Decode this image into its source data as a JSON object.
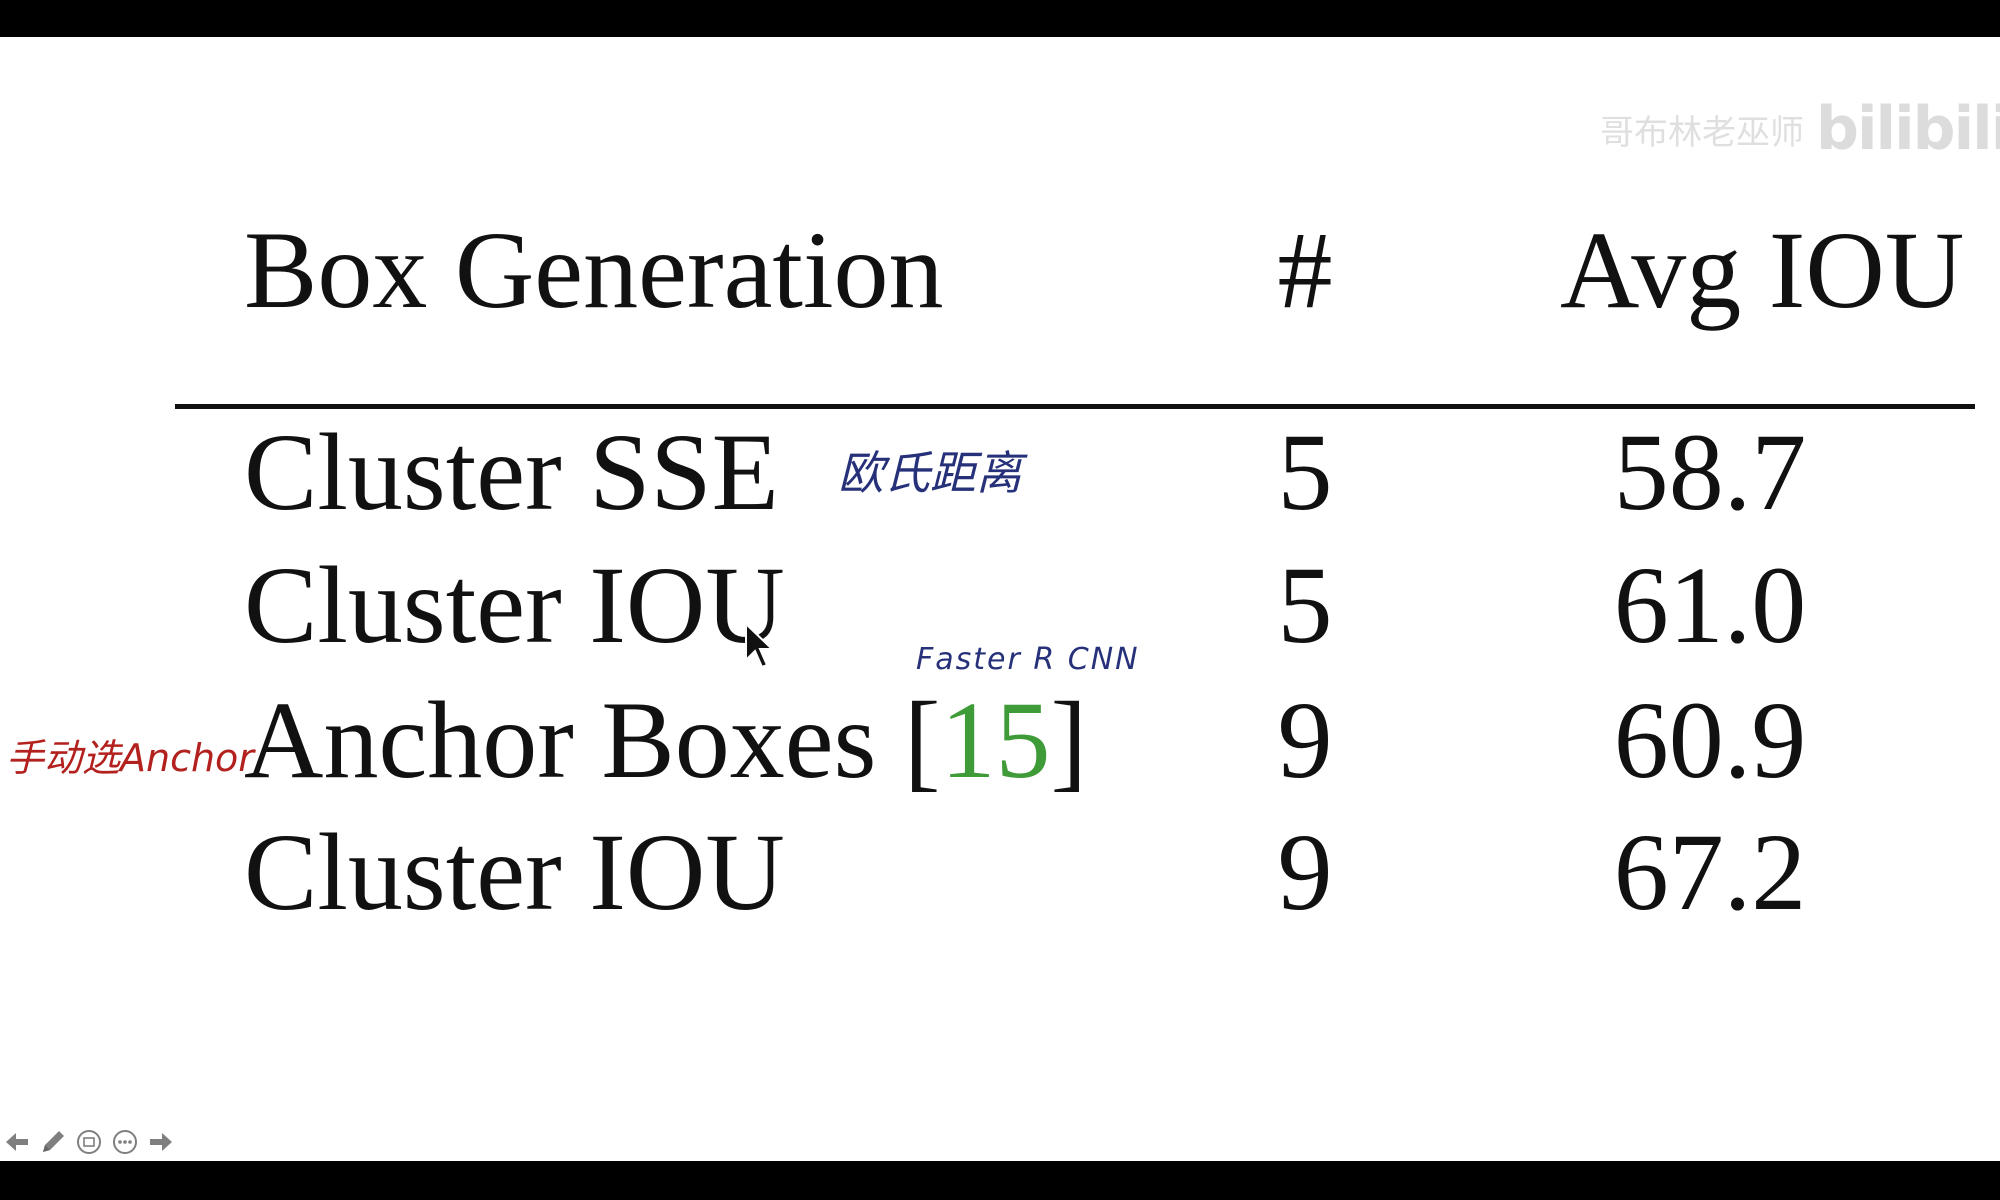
{
  "watermark": {
    "text": "哥布林老巫师",
    "logo_text": "bilibili"
  },
  "table": {
    "headers": {
      "box_generation": "Box Generation",
      "count": "#",
      "avg_iou": "Avg IOU"
    },
    "rows": [
      {
        "method": "Cluster SSE",
        "count": "5",
        "avg_iou": "58.7"
      },
      {
        "method": "Cluster IOU",
        "count": "5",
        "avg_iou": "61.0"
      },
      {
        "method": "Anchor Boxes [",
        "ref": "15",
        "ref_close": "]",
        "count": "9",
        "avg_iou": "60.9"
      },
      {
        "method": "Cluster IOU",
        "count": "9",
        "avg_iou": "67.2"
      }
    ]
  },
  "annotations": {
    "euclidean": "欧氏距离",
    "faster_rcnn": "Faster R CNN",
    "manual_anchor": "手动选Anchor"
  },
  "colors": {
    "reference_green": "#3f9b37",
    "note_blue": "#26317a",
    "note_red": "#b3211e"
  },
  "toolbar": {
    "icons": [
      "arrow-left-icon",
      "pen-icon",
      "slides-icon",
      "more-icon",
      "arrow-right-icon"
    ]
  }
}
